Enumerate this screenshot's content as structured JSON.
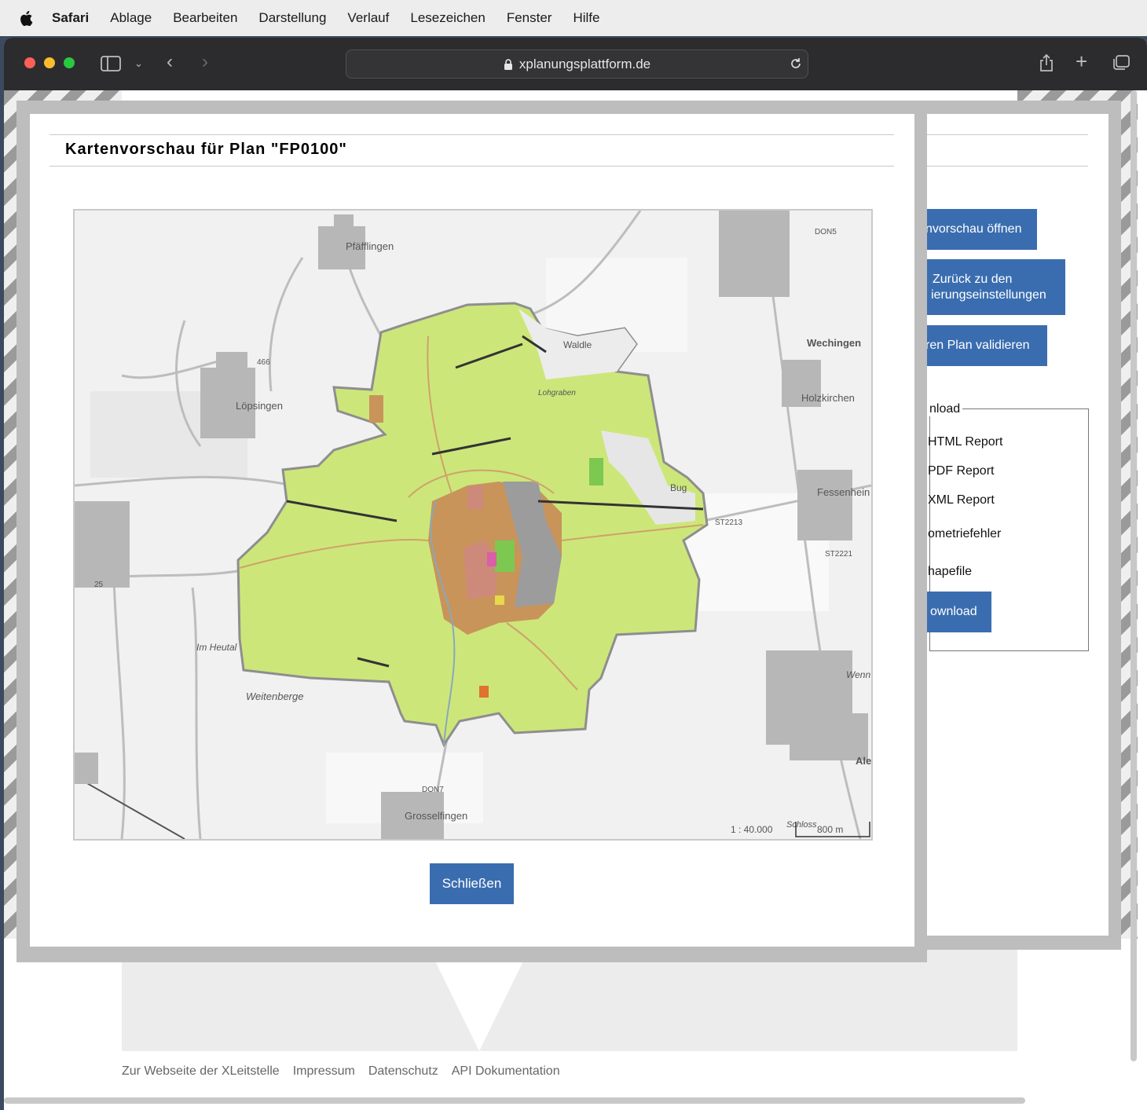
{
  "menubar": {
    "app": "Safari",
    "items": [
      "Ablage",
      "Bearbeiten",
      "Darstellung",
      "Verlauf",
      "Lesezeichen",
      "Fenster",
      "Hilfe"
    ]
  },
  "browser": {
    "url": "xplanungsplattform.de"
  },
  "background_panel": {
    "buttons": {
      "open_preview": "nvorschau öffnen",
      "back_line1": "Zurück zu den",
      "back_line2": "ierungseinstellungen",
      "validate": "ren Plan validieren",
      "download": "ownload"
    },
    "download_group": {
      "legend": "nload",
      "options": [
        "HTML Report",
        "PDF Report",
        "XML Report",
        "ometriefehler",
        "hapefile"
      ]
    }
  },
  "modal": {
    "title": "Kartenvorschau für Plan \"FP0100\"",
    "close_label": "Schließen",
    "map": {
      "places": [
        "Pfäfflingen",
        "Löpsingen",
        "Wechingen",
        "Holzkirchen",
        "Fessenhein",
        "Wenn",
        "Ale",
        "Grosselfingen",
        "Weitenberge",
        "Im Heutal",
        "Waldle",
        "Lohgraben",
        "Bug",
        "Schloss"
      ],
      "road_labels": [
        "466",
        "25",
        "DON5",
        "ST2213",
        "ST2221",
        "DON7"
      ],
      "scale_ratio": "1 : 40.000",
      "scale_bar": "800 m"
    }
  },
  "footer": {
    "links": [
      "Zur Webseite der XLeitstelle",
      "Impressum",
      "Datenschutz",
      "API Dokumentation"
    ]
  },
  "colors": {
    "primary_button": "#3a6db0",
    "plan_green": "#cde67a",
    "plan_brown": "#c8945a",
    "plan_gray": "#9c9c9c"
  }
}
